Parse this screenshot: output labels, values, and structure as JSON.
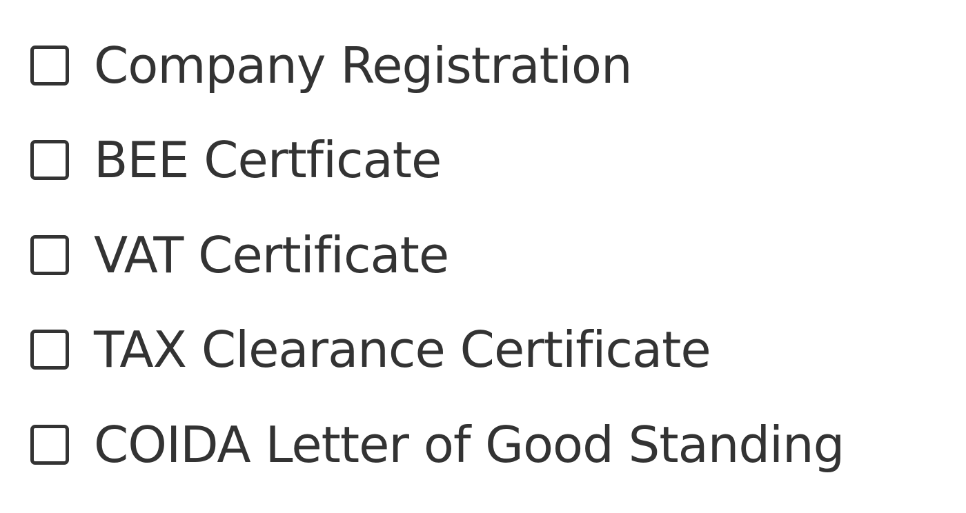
{
  "checklist": {
    "items": [
      {
        "label": "Company Registration",
        "checked": false
      },
      {
        "label": "BEE Certficate",
        "checked": false
      },
      {
        "label": "VAT Certificate",
        "checked": false
      },
      {
        "label": "TAX Clearance Certificate",
        "checked": false
      },
      {
        "label": "COIDA Letter of Good Standing",
        "checked": false
      }
    ]
  },
  "colors": {
    "text": "#333333",
    "background": "#ffffff"
  }
}
